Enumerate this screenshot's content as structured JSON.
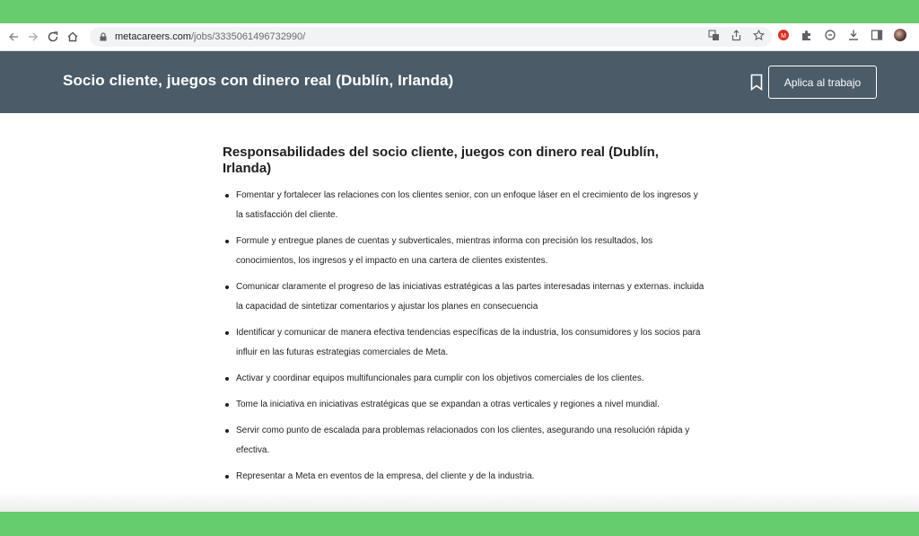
{
  "browser": {
    "url_host": "metacareers.com",
    "url_path": "/jobs/3335061496732990/"
  },
  "header": {
    "title": "Socio cliente, juegos con dinero real (Dublín, Irlanda)",
    "apply_label": "Aplica al trabajo"
  },
  "main": {
    "section_title": "Responsabilidades del socio cliente, juegos con dinero real (Dublín, Irlanda)",
    "items": [
      "Fomentar y fortalecer las relaciones con los clientes senior, con un enfoque láser en el crecimiento de los ingresos y la satisfacción del cliente.",
      "Formule y entregue planes de cuentas y subverticales, mientras informa con precisión los resultados, los conocimientos, los ingresos y el impacto en una cartera de clientes existentes.",
      "Comunicar claramente el progreso de las iniciativas estratégicas a las partes interesadas internas y externas. incluida la capacidad de sintetizar comentarios y ajustar los planes en consecuencia",
      "Identificar y comunicar de manera efectiva tendencias específicas de la industria, los consumidores y los socios para influir en las futuras estrategias comerciales de Meta.",
      "Activar y coordinar equipos multifuncionales para cumplir con los objetivos comerciales de los clientes.",
      "Tome la iniciativa en iniciativas estratégicas que se expandan a otras verticales y regiones a nivel mundial.",
      "Servir como punto de escalada para problemas relacionados con los clientes, asegurando una resolución rápida y efectiva.",
      "Representar a Meta en eventos de la empresa, del cliente y de la industria."
    ]
  },
  "colors": {
    "background_green": "#66cc6e",
    "header_bg": "#4b5b68"
  }
}
